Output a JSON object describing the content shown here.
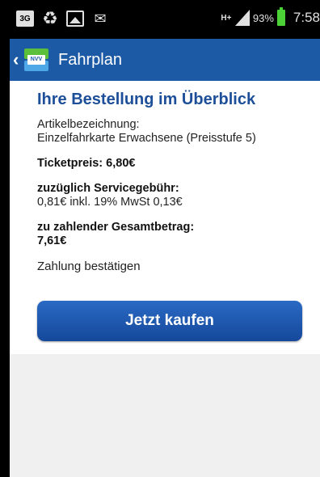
{
  "statusbar": {
    "left_icons": [
      "sim-3g-icon",
      "recycle-icon",
      "image-icon",
      "missed-call-icon"
    ],
    "network": "H+",
    "battery_percent": "93%",
    "time": "7:58"
  },
  "actionbar": {
    "title": "Fahrplan",
    "logo_text": "NVV"
  },
  "summary": {
    "heading": "Ihre Bestellung im Überblick",
    "article_label": "Artikelbezeichnung:",
    "article_value": "Einzelfahrkarte Erwachsene (Preisstufe 5)",
    "ticket_price": "Ticketpreis: 6,80€",
    "service_fee_label": "zuzüglich Servicegebühr:",
    "service_fee_value": "0,81€ inkl. 19% MwSt 0,13€",
    "total_label": "zu zahlender Gesamtbetrag:",
    "total_value": "7,61€",
    "confirm_text": "Zahlung bestätigen"
  },
  "buttons": {
    "buy": "Jetzt kaufen"
  },
  "colors": {
    "actionbar": "#1c5aa6",
    "heading": "#1d4f99",
    "button": "#1a57ad"
  }
}
